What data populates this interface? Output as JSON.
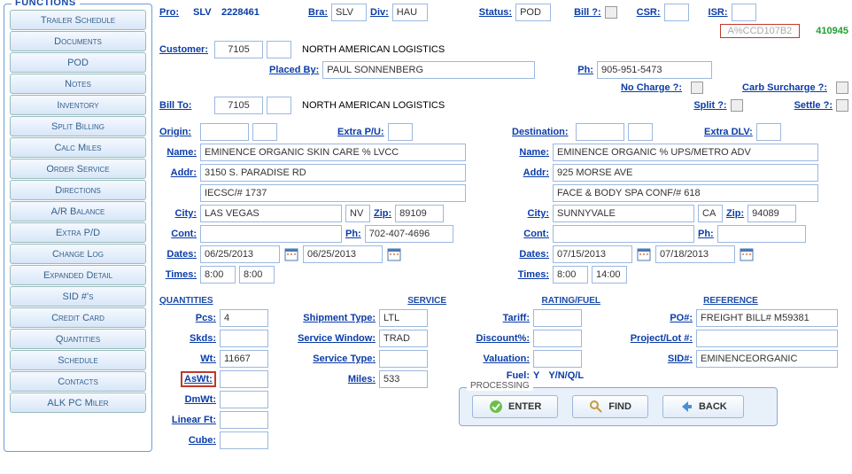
{
  "functions": {
    "title": "FUNCTIONS",
    "buttons": [
      "Trailer Schedule",
      "Documents",
      "POD",
      "Notes",
      "Inventory",
      "Split Billing",
      "Calc Miles",
      "Order Service",
      "Directions",
      "A/R Balance",
      "Extra P/D",
      "Change Log",
      "Expanded Detail",
      "SID #'s",
      "Credit Card",
      "Quantities",
      "Schedule",
      "Contacts",
      "ALK PC Miler"
    ]
  },
  "header": {
    "pro_lbl": "Pro:",
    "pro_prefix": "SLV",
    "pro_num": "2228461",
    "bra_lbl": "Bra:",
    "bra": "SLV",
    "div_lbl": "Div:",
    "div": "HAU",
    "status_lbl": "Status:",
    "status": "POD",
    "bill_q_lbl": "Bill ?:",
    "csr_lbl": "CSR:",
    "isr_lbl": "ISR:",
    "ghost_code": "A%CCD107B2",
    "green_code": "410945"
  },
  "customer": {
    "lbl": "Customer:",
    "code": "7105",
    "name": "NORTH AMERICAN LOGISTICS",
    "placed_by_lbl": "Placed By:",
    "placed_by": "PAUL SONNENBERG",
    "ph_lbl": "Ph:",
    "ph": "905-951-5473",
    "no_charge_lbl": "No Charge ?:",
    "carb_lbl": "Carb Surcharge ?:",
    "split_lbl": "Split ?:",
    "settle_lbl": "Settle ?:"
  },
  "billto": {
    "lbl": "Bill To:",
    "code": "7105",
    "name": "NORTH AMERICAN LOGISTICS"
  },
  "origin": {
    "title_lbl": "Origin:",
    "extra_lbl": "Extra P/U:",
    "name_lbl": "Name:",
    "name": "EMINENCE ORGANIC SKIN CARE % LVCC",
    "addr_lbl": "Addr:",
    "addr1": "3150 S. PARADISE RD",
    "addr2": "IECSC/# 1737",
    "city_lbl": "City:",
    "city": "LAS VEGAS",
    "state": "NV",
    "zip_lbl": "Zip:",
    "zip": "89109",
    "cont_lbl": "Cont:",
    "cont": "",
    "ph_lbl": "Ph:",
    "ph": "702-407-4696",
    "dates_lbl": "Dates:",
    "date1": "06/25/2013",
    "date2": "06/25/2013",
    "times_lbl": "Times:",
    "time1": "8:00",
    "time2": "8:00"
  },
  "dest": {
    "title_lbl": "Destination:",
    "extra_lbl": "Extra DLV:",
    "name_lbl": "Name:",
    "name": "EMINENCE ORGANIC % UPS/METRO ADV",
    "addr_lbl": "Addr:",
    "addr1": "925 MORSE AVE",
    "addr2": "FACE & BODY SPA CONF/# 618",
    "city_lbl": "City:",
    "city": "SUNNYVALE",
    "state": "CA",
    "zip_lbl": "Zip:",
    "zip": "94089",
    "cont_lbl": "Cont:",
    "cont": "",
    "ph_lbl": "Ph:",
    "ph": "",
    "dates_lbl": "Dates:",
    "date1": "07/15/2013",
    "date2": "07/18/2013",
    "times_lbl": "Times:",
    "time1": "8:00",
    "time2": "14:00"
  },
  "quantities": {
    "title": "QUANTITIES",
    "pcs_lbl": "Pcs:",
    "pcs": "4",
    "skds_lbl": "Skds:",
    "skds": "",
    "wt_lbl": "Wt:",
    "wt": "11667",
    "aswt_lbl": "AsWt:",
    "aswt": "",
    "dmwt_lbl": "DmWt:",
    "dmwt": "",
    "lf_lbl": "Linear Ft:",
    "lf": "",
    "cube_lbl": "Cube:",
    "cube": ""
  },
  "service": {
    "title": "SERVICE",
    "ship_type_lbl": "Shipment Type:",
    "ship_type": "LTL",
    "svc_win_lbl": "Service Window:",
    "svc_win": "TRAD",
    "svc_type_lbl": "Service Type:",
    "svc_type": "",
    "miles_lbl": "Miles:",
    "miles": "533"
  },
  "rating": {
    "title": "RATING/FUEL",
    "tariff_lbl": "Tariff:",
    "tariff": "",
    "discount_lbl": "Discount%:",
    "discount": "",
    "valuation_lbl": "Valuation:",
    "valuation": "",
    "fuel_lbl": "Fuel:",
    "fuel_val": "Y",
    "fuel_opts": "Y/N/Q/L"
  },
  "reference": {
    "title": "REFERENCE",
    "po_lbl": "PO#:",
    "po": "FREIGHT BILL# M59381",
    "proj_lbl": "Project/Lot #:",
    "proj": "",
    "sid_lbl": "SID#:",
    "sid": "EMINENCEORGANIC"
  },
  "processing": {
    "title": "PROCESSING",
    "enter": "ENTER",
    "find": "FIND",
    "back": "BACK"
  }
}
